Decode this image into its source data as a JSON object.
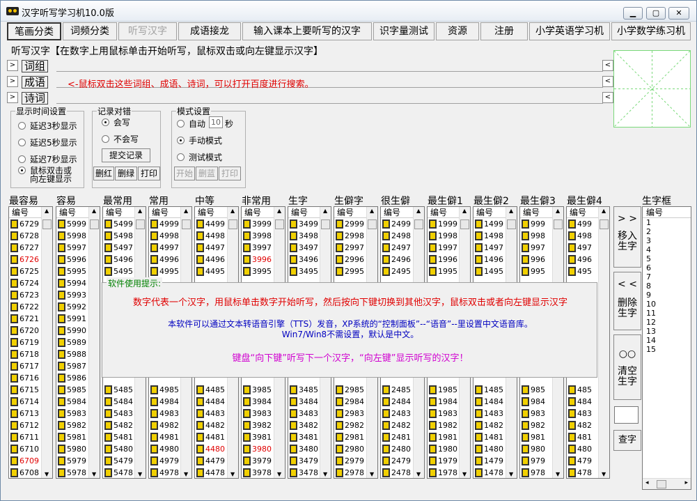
{
  "window": {
    "title": "汉字听写学习机10.0版",
    "min": "▭",
    "max": "▢",
    "close": "✕"
  },
  "tabs": [
    {
      "label": "笔画分类"
    },
    {
      "label": "词频分类"
    },
    {
      "label": "听写汉字"
    },
    {
      "label": "成语接龙"
    },
    {
      "label": "输入课本上要听写的汉字"
    },
    {
      "label": "识字量测试"
    },
    {
      "label": "资源"
    },
    {
      "label": "注册"
    },
    {
      "label": "小学英语学习机"
    },
    {
      "label": "小学数学练习机"
    }
  ],
  "heading": "听写汉字【在数字上用鼠标单击开始听写，鼠标双击或向左键显示汉字】",
  "rows": [
    {
      "btn": ">",
      "label": "词组",
      "rbtn": "<"
    },
    {
      "btn": ">",
      "label": "成语",
      "rbtn": "<"
    },
    {
      "btn": ">",
      "label": "诗词",
      "rbtn": "<"
    }
  ],
  "search_hint": "<-鼠标双击这些词组、成语、诗词，可以打开百度进行搜索。",
  "time_settings": {
    "legend": "显示时间设置",
    "options": [
      "延迟3秒显示",
      "延迟5秒显示",
      "延迟7秒显示",
      "鼠标双击或",
      "向左键显示"
    ]
  },
  "record": {
    "legend": "记录对错",
    "options": [
      "会写",
      "不会写"
    ],
    "submit": "提交记录",
    "buttons": [
      "删红",
      "删绿",
      "打印"
    ]
  },
  "mode": {
    "legend": "模式设置",
    "auto": "自动",
    "auto_value": "10",
    "seconds": "秒",
    "manual": "手动模式",
    "test": "测试模式",
    "buttons": [
      "开始",
      "删蓝",
      "打印"
    ]
  },
  "column_header_label": "编号",
  "columns": [
    {
      "title": "最容易",
      "values": [
        "6729",
        "6728",
        "6727",
        "6726",
        "6725",
        "6724",
        "6723",
        "6722",
        "6721",
        "6720",
        "6719",
        "6718",
        "6717",
        "6716",
        "6715",
        "6714",
        "6713",
        "6712",
        "6711",
        "6710",
        "6709",
        "6708"
      ],
      "red": [
        3,
        20
      ]
    },
    {
      "title": "容易",
      "values": [
        "5999",
        "5998",
        "5997",
        "5996",
        "5995",
        "5994",
        "5993",
        "5992",
        "5991",
        "5990",
        "5989",
        "5988",
        "5987",
        "5986",
        "5985",
        "5984",
        "5983",
        "5982",
        "5981",
        "5980",
        "5979",
        "5978"
      ],
      "red": []
    },
    {
      "title": "最常用",
      "top": [
        "5499",
        "5498",
        "5497",
        "5496",
        "5495"
      ],
      "bottom": [
        "5485",
        "5484",
        "5483",
        "5482",
        "5481",
        "5480",
        "5479",
        "5478"
      ]
    },
    {
      "title": "常用",
      "top": [
        "4999",
        "4998",
        "4997",
        "4996",
        "4995"
      ],
      "bottom": [
        "4985",
        "4984",
        "4983",
        "4982",
        "4981",
        "4980",
        "4979",
        "4978"
      ]
    },
    {
      "title": "中等",
      "top": [
        "4499",
        "4498",
        "4497",
        "4496",
        "4495"
      ],
      "bottom": [
        "4485",
        "4484",
        "4483",
        "4482",
        "4481",
        "4480",
        "4479",
        "4478"
      ],
      "red_bottom": [
        5
      ]
    },
    {
      "title": "非常用",
      "top": [
        "3999",
        "3998",
        "3997",
        "3996",
        "3995"
      ],
      "bottom": [
        "3985",
        "3984",
        "3983",
        "3982",
        "3981",
        "3980",
        "3979",
        "3978"
      ],
      "red_top": [
        3
      ],
      "red_bottom": [
        5
      ]
    },
    {
      "title": "生字",
      "top": [
        "3499",
        "3498",
        "3497",
        "3496",
        "3495"
      ],
      "bottom": [
        "3485",
        "3484",
        "3483",
        "3482",
        "3481",
        "3480",
        "3479",
        "3478"
      ]
    },
    {
      "title": "生僻字",
      "top": [
        "2999",
        "2998",
        "2997",
        "2996",
        "2995"
      ],
      "bottom": [
        "2985",
        "2984",
        "2983",
        "2982",
        "2981",
        "2980",
        "2979",
        "2978"
      ]
    },
    {
      "title": "很生僻",
      "top": [
        "2499",
        "2498",
        "2497",
        "2496",
        "2495"
      ],
      "bottom": [
        "2485",
        "2484",
        "2483",
        "2482",
        "2481",
        "2480",
        "2479",
        "2478"
      ]
    },
    {
      "title": "最生僻1",
      "top": [
        "1999",
        "1998",
        "1997",
        "1996",
        "1995"
      ],
      "bottom": [
        "1985",
        "1984",
        "1983",
        "1982",
        "1981",
        "1980",
        "1979",
        "1978"
      ]
    },
    {
      "title": "最生僻2",
      "top": [
        "1499",
        "1498",
        "1497",
        "1496",
        "1495"
      ],
      "bottom": [
        "1485",
        "1484",
        "1483",
        "1482",
        "1481",
        "1480",
        "1479",
        "1478"
      ]
    },
    {
      "title": "最生僻3",
      "top": [
        "999",
        "998",
        "997",
        "996",
        "995"
      ],
      "bottom": [
        "985",
        "984",
        "983",
        "982",
        "981",
        "980",
        "979",
        "978"
      ]
    },
    {
      "title": "最生僻4",
      "top": [
        "499",
        "498",
        "497",
        "496",
        "495"
      ],
      "bottom": [
        "485",
        "484",
        "483",
        "482",
        "481",
        "480",
        "479",
        "478"
      ]
    }
  ],
  "tip": {
    "title": "软件使用提示:",
    "line1": "数字代表一个汉字，用鼠标单击数字开始听写，然后按向下键切换到其他汉字，鼠标双击或者向左键显示汉字",
    "line2": "本软件可以通过文本转语音引擎（TTS）发音，XP系统的“控制面板”--“语音”--里设置中文语音库。",
    "line3": "Win7/Win8不需设置，默认是中文。",
    "line4": "键盘“向下键”听写下一个汉字，“向左键”显示听写的汉字！"
  },
  "side": {
    "add_arrow": "> >",
    "add_label1": "移入",
    "add_label2": "生字",
    "del_arrow": "< <",
    "del_label1": "删除",
    "del_label2": "生字",
    "clear_icon": "○○",
    "clear_label1": "清空",
    "clear_label2": "生字",
    "lookup": "查字"
  },
  "charbox": {
    "title": "生字框",
    "header": "编号",
    "numbers": [
      "1",
      "2",
      "3",
      "4",
      "5",
      "6",
      "7",
      "8",
      "9",
      "10",
      "11",
      "12",
      "13",
      "14",
      "15"
    ]
  }
}
